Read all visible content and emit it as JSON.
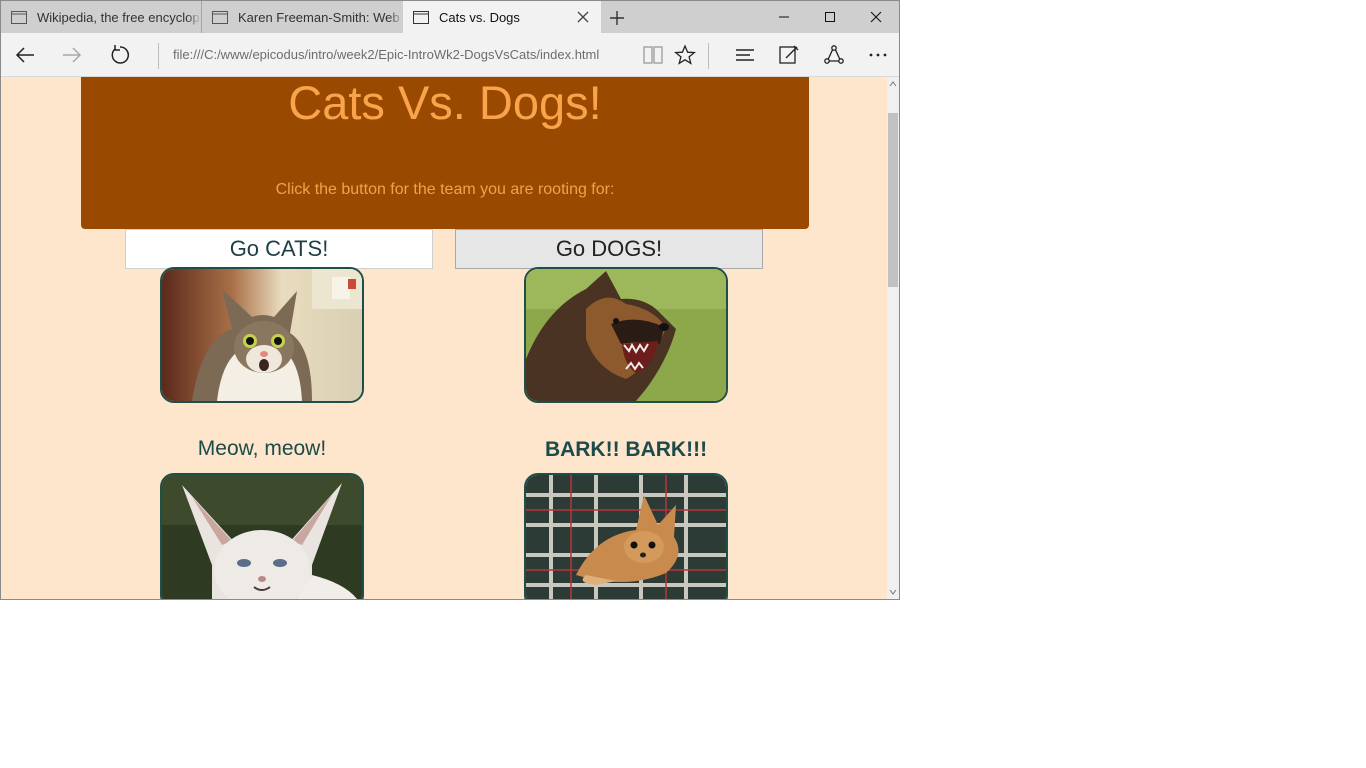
{
  "browser": {
    "tabs": [
      {
        "title": "Wikipedia, the free encyclop",
        "active": false
      },
      {
        "title": "Karen Freeman-Smith: Web",
        "active": false
      },
      {
        "title": "Cats vs. Dogs",
        "active": true
      }
    ],
    "address": "file:///C:/www/epicodus/intro/week2/Epic-IntroWk2-DogsVsCats/index.html"
  },
  "page": {
    "title": "Cats Vs. Dogs!",
    "subtitle": "Click the button for the team you are rooting for:",
    "buttons": {
      "cats": "Go CATS!",
      "dogs": "Go DOGS!"
    },
    "captions": {
      "cats": "Meow, meow!",
      "dogs": "BARK!! BARK!!!"
    }
  },
  "colors": {
    "page_bg": "#fde6cc",
    "hero_bg": "#9a4a00",
    "hero_text": "#f9a34b",
    "caption_text": "#1d4a4a",
    "image_border": "#1f4f4a"
  },
  "icons": [
    "page-icon",
    "close-icon",
    "plus-icon",
    "minimize-icon",
    "maximize-icon",
    "back-arrow-icon",
    "forward-arrow-icon",
    "refresh-icon",
    "reading-view-icon",
    "star-icon",
    "hub-icon",
    "web-note-icon",
    "share-icon",
    "more-icon"
  ]
}
